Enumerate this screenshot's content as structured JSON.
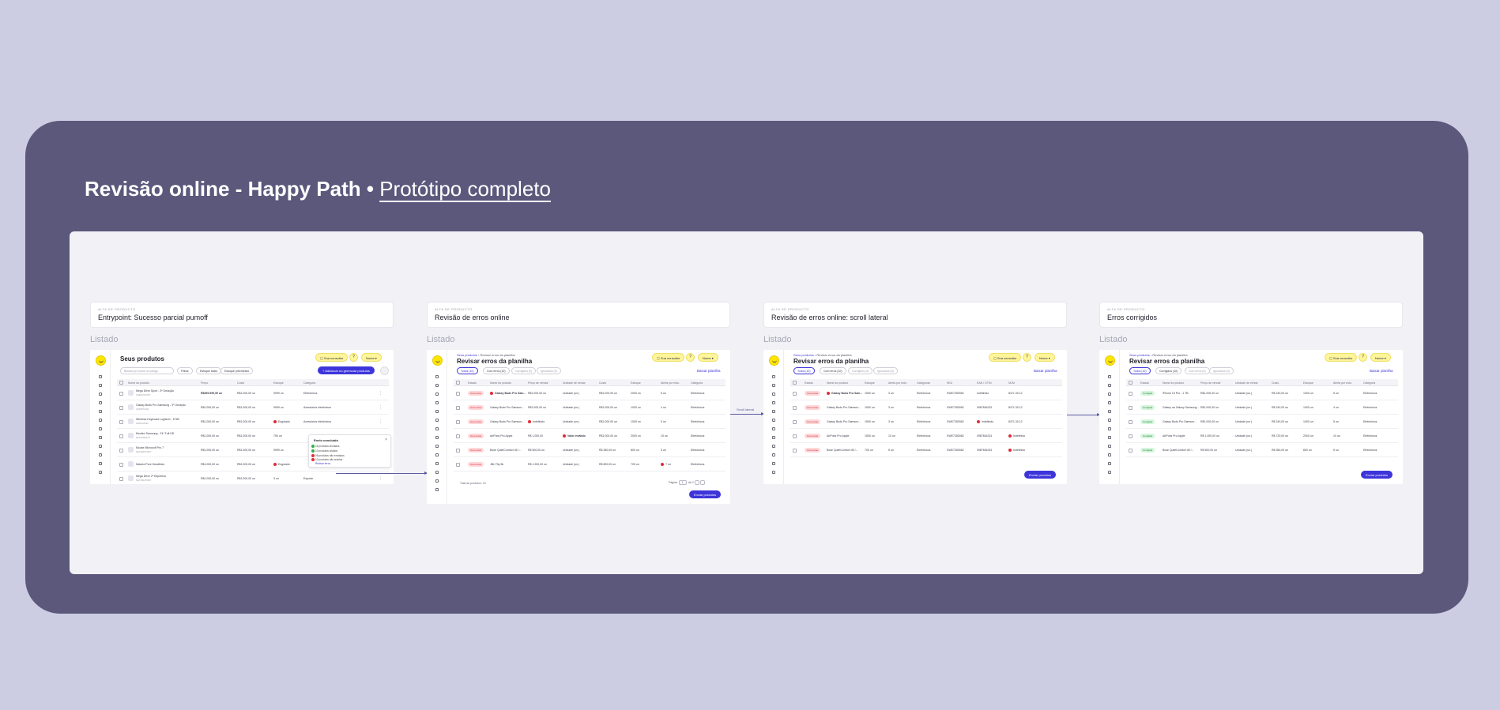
{
  "hero": {
    "title_bold": "Revisão online - Happy Path • ",
    "title_link": "Protótipo completo"
  },
  "frames": [
    {
      "eyebrow": "Alta de producto",
      "title": "Entrypoint: Sucesso parcial pumoff",
      "label": "Listado",
      "page_title": "Seus produtos",
      "header": {
        "help": "Sua consultor",
        "q": "?",
        "user": "Nome"
      },
      "search_placeholder": "Buscar por nome ou código",
      "chips": [
        "Filtros",
        "Estoque baixo",
        "Estoque preenchido"
      ],
      "primary_button": "+ Adicionar ou gerenciar produtos",
      "columns": [
        "Nome do produto",
        "Preço",
        "Custo",
        "Estoque",
        "Categoria"
      ],
      "rows": [
        {
          "name": "Mega Drive Sport - 3ª Geração",
          "sku": "SUB24784787",
          "price": "R$999.999,99 un",
          "cost": "R$1.000,00 un",
          "stock": "9999 un",
          "category": "Eletrônicos"
        },
        {
          "name": "Galaxy Buds Pro Samsung - 3ª Geração",
          "sku": "Q3P2872941",
          "price": "R$1.000,00 un",
          "cost": "R$1.000,00 un",
          "stock": "9999 un",
          "category": "Acessórios eletrônicos"
        },
        {
          "name": "Wireless Keyboard Logitech - K780",
          "sku": "WRK324249",
          "price": "R$1.000,00 un",
          "cost": "R$1.000,00 un",
          "stock": "Esgotado",
          "category": "Acessórios eletrônicos"
        },
        {
          "name": "Monitor Samsung - 24\" Full HD",
          "sku": "MON2082478",
          "price": "R$1.000,00 un",
          "cost": "R$1.000,00 un",
          "stock": "750 un",
          "category": ""
        },
        {
          "name": "Mouse Microsoft Pro 7",
          "sku": "NE7393270827",
          "price": "R$1.000,00 un",
          "cost": "R$1.000,00 un",
          "stock": "9999 un",
          "category": ""
        },
        {
          "name": "Naturia Pure Headlines",
          "sku": "",
          "price": "R$1.000,00 un",
          "cost": "R$1.000,00 un",
          "stock": "Esgotado",
          "category": ""
        },
        {
          "name": "Mega Drive 2ª Esportiva",
          "sku": "NE7393270827",
          "price": "R$1.000,00 un",
          "cost": "R$1.000,00 un",
          "stock": "3 un",
          "category": "Esporte"
        }
      ],
      "popup": {
        "title": "Envio concluído",
        "lines": [
          "15 produtos enviados",
          "10 produtos criados",
          "05 produtos não enviados",
          "10 produtos não criados"
        ],
        "more": "Revisar erros"
      }
    },
    {
      "eyebrow": "Alta de producto",
      "title": "Revisão de erros online",
      "label": "Listado",
      "crumb_link": "Seus produtos",
      "crumb_current": "Revisar erros da planilha",
      "page_title": "Revisar erros da planilha",
      "header": {
        "help": "Sua consultor",
        "q": "?",
        "user": "Nome"
      },
      "chips": [
        "Todos (10)",
        "Com erros (10)",
        "Corrigidos (0)",
        "Ignorados (0)"
      ],
      "top_link": "Baixar planilha",
      "columns": [
        "Estado",
        "Nome do produto",
        "Preço de vendor",
        "Unidade de venda",
        "Custo",
        "Estoque",
        "Alerta por esto.",
        "Categoria"
      ],
      "rows": [
        {
          "state": "Com erros",
          "name": "Galaxy Buds Pro Sam...",
          "price": "R$1.000,00 un",
          "unit": "Unidade (un.)",
          "cost": "R$1.000,00 un",
          "stock": "2000 un",
          "alert": "5 un",
          "cat": "Eletrônicos"
        },
        {
          "state": "Com erros",
          "name": "Galaxy Buds Pro Samsun...",
          "price": "R$1.000,00 un",
          "unit": "Unidade (un.)",
          "cost": "R$1.000,00 un",
          "stock": "1000 un",
          "alert": "4 un",
          "cat": "Eletrônicos"
        },
        {
          "state": "Com erros",
          "name": "Galaxy Buds Pro Samsun...",
          "price": "Indefinido",
          "unit": "Unidade (un.)",
          "cost": "R$1.000,00 un",
          "stock": "1000 un",
          "alert": "5 un",
          "cat": "Eletrônicos"
        },
        {
          "state": "Com erros",
          "name": "AirPods Pro Apple",
          "price": "R$ 1.000,00",
          "unit": "Valor inválido",
          "cost": "R$1.000,00 un",
          "stock": "2000 un",
          "alert": "10 un",
          "cat": "Eletrônicos"
        },
        {
          "state": "Com erros",
          "name": "Bose QuietComfort 45 /...",
          "price": "R$ 500,00 un",
          "unit": "Unidade (un.)",
          "cost": "R$ 350,00 un",
          "stock": "800 un",
          "alert": "5 un",
          "cat": "Eletrônicos"
        },
        {
          "state": "Com erros",
          "name": "JBL Flip 5k",
          "price": "R$ 1.200,00 un",
          "unit": "Unidade (un.)",
          "cost": "R$ 800,00 un",
          "stock": "700 un",
          "alert": "7 un",
          "cat": "Eletrônicos"
        }
      ],
      "footer_total": "Total de produtos: 15",
      "pager": {
        "label": "Página",
        "page": "1",
        "of": "de 2"
      },
      "send_button": "Enviar produtos"
    },
    {
      "eyebrow": "Alta de producto",
      "title": "Revisão de erros online: scroll lateral",
      "label": "Listado",
      "crumb_link": "Seus produtos",
      "crumb_current": "Revisar erros da planilha",
      "page_title": "Revisar erros da planilha",
      "header": {
        "help": "Sua consultor",
        "q": "?",
        "user": "Nome"
      },
      "chips": [
        "Todos (10)",
        "Com erros (10)",
        "Corrigidos (0)",
        "Ignorados (0)"
      ],
      "top_link": "Baixar planilha",
      "columns": [
        "Estado",
        "Nome do produto",
        "Estoque",
        "Alerta por esto.",
        "Categorias",
        "SKU",
        "EAN / GTIN",
        "NCM"
      ],
      "rows": [
        {
          "state": "Com erros",
          "name": "Galaxy Buds Pro Sam...",
          "stock": "1500 un",
          "alert": "3 un",
          "cat": "Eletrônicos",
          "sku": "SWE7283962",
          "ean": "Indefinido",
          "ncm": "8471.30.12"
        },
        {
          "state": "Com erros",
          "name": "Galaxy Buds Pro Samsun...",
          "stock": "1500 un",
          "alert": "3 un",
          "cat": "Eletrônicos",
          "sku": "SWE7283962",
          "ean": "0987654321",
          "ncm": "8471.30.12"
        },
        {
          "state": "Com erros",
          "name": "Galaxy Buds Pro Samsun...",
          "stock": "1500 un",
          "alert": "3 un",
          "cat": "Eletrônicos",
          "sku": "SWE7283962",
          "ean": "Indefinido",
          "ncm": "8471.30.12"
        },
        {
          "state": "Com erros",
          "name": "AirPods Pro Apple",
          "stock": "1500 un",
          "alert": "10 un",
          "cat": "Eletrônicos",
          "sku": "SWE7283962",
          "ean": "0987654321",
          "ncm": "Indefinido"
        },
        {
          "state": "Com erros",
          "name": "Bose QuietComfort 45 /...",
          "stock": "700 un",
          "alert": "5 un",
          "cat": "Eletrônicos",
          "sku": "SWE7283962",
          "ean": "0987654321",
          "ncm": "Indefinido"
        }
      ],
      "send_button": "Enviar produtos"
    },
    {
      "eyebrow": "Alta de producto",
      "title": "Erros corrigidos",
      "label": "Listado",
      "crumb_link": "Seus produtos",
      "crumb_current": "Revisar erros da planilha",
      "page_title": "Revisar erros da planilha",
      "header": {
        "help": "Sua consultor",
        "q": "?",
        "user": "Nome"
      },
      "chips": [
        "Todos (10)",
        "Corrigidos (10)",
        "Com erros (0)",
        "Ignorados (0)"
      ],
      "top_link": "Baixar planilha",
      "columns": [
        "Estado",
        "Nome do produto",
        "Preço de vendor",
        "Unidade de venda",
        "Custo",
        "Estoque",
        "Alerta por esto.",
        "Categoria"
      ],
      "rows": [
        {
          "state": "Corrigido",
          "name": "iPhone 15 Pro - 1 TB",
          "price": "R$1.000,00 un",
          "unit": "Unidade (un.)",
          "cost": "R$ 240,00 un",
          "stock": "1000 un",
          "alert": "5 un",
          "cat": "Eletrônicos"
        },
        {
          "state": "Corrigido",
          "name": "Galaxy na Galaxy Samsung...",
          "price": "R$1.000,00 un",
          "unit": "Unidade (un.)",
          "cost": "R$ 240,00 un",
          "stock": "1000 un",
          "alert": "4 un",
          "cat": "Eletrônicos"
        },
        {
          "state": "Corrigido",
          "name": "Galaxy Buds Pro Samsun...",
          "price": "R$1.000,00 un",
          "unit": "Unidade (un.)",
          "cost": "R$ 240,00 un",
          "stock": "1000 un",
          "alert": "5 un",
          "cat": "Eletrônicos"
        },
        {
          "state": "Corrigido",
          "name": "AirPods Pro Apple",
          "price": "R$ 1.000,00 un",
          "unit": "Unidade (un.)",
          "cost": "R$ 720,00 un",
          "stock": "2000 un",
          "alert": "10 un",
          "cat": "Eletrônicos"
        },
        {
          "state": "Corrigido",
          "name": "Bose QuietComfort 45 /...",
          "price": "R$ 500,00 un",
          "unit": "Unidade (un.)",
          "cost": "R$ 350,00 un",
          "stock": "800 un",
          "alert": "5 un",
          "cat": "Eletrônicos"
        }
      ],
      "send_button": "Enviar produtos"
    }
  ],
  "connector_label": "Scroll lateral",
  "colors": {
    "background": "#cccde2",
    "panel": "#5b587c",
    "canvas": "#f1f1f6",
    "accent": "#3d35d9",
    "brand_yellow": "#ffe600",
    "error": "#e22c38",
    "success": "#217a35"
  }
}
